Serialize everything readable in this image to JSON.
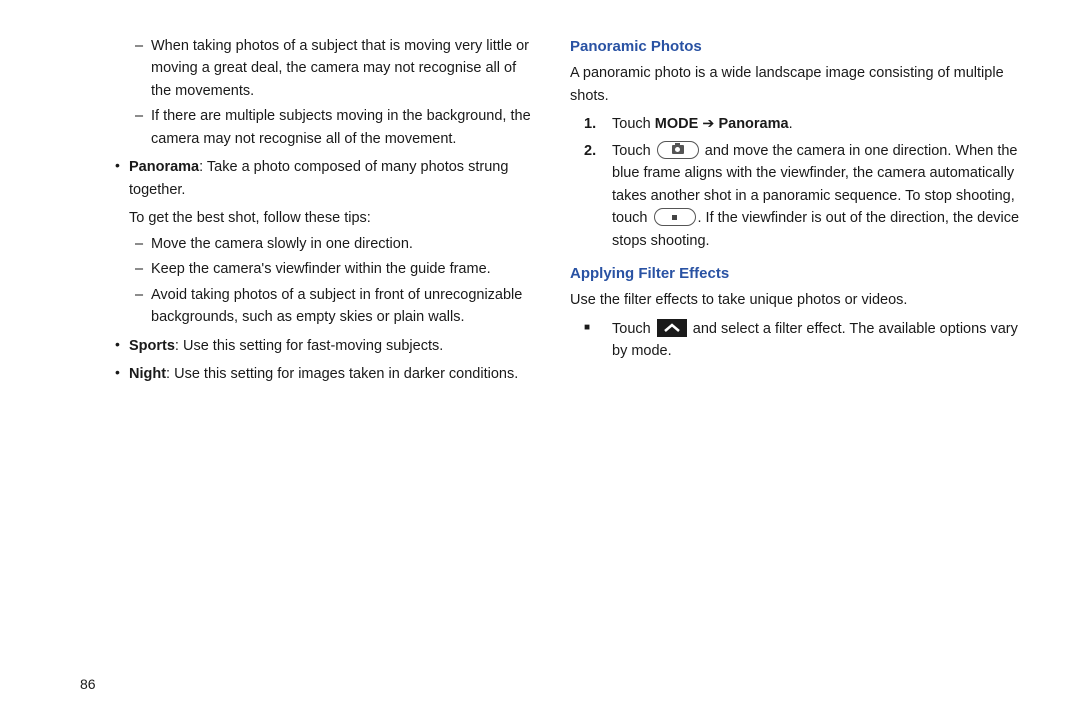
{
  "page_number": "86",
  "left": {
    "dash1": "When taking photos of a subject that is moving very little or moving a great deal, the camera may not recognise all of the movements.",
    "dash2": "If there are multiple subjects moving in the background, the camera may not recognise all of the movement.",
    "panorama_label": "Panorama",
    "panorama_text": ": Take a photo composed of many photos strung together.",
    "tips_intro": "To get the best shot, follow these tips:",
    "tip1": "Move the camera slowly in one direction.",
    "tip2": "Keep the camera's viewfinder within the guide frame.",
    "tip3": "Avoid taking photos of a subject in front of unrecognizable backgrounds, such as empty skies or plain walls.",
    "sports_label": "Sports",
    "sports_text": ": Use this setting for fast-moving subjects.",
    "night_label": "Night",
    "night_text": ": Use this setting for images taken in darker conditions."
  },
  "right": {
    "heading1": "Panoramic Photos",
    "para1": "A panoramic photo is a wide landscape image consisting of multiple shots.",
    "step1_pre": "Touch ",
    "step1_mode": "MODE",
    "step1_arrow": " ➔ ",
    "step1_panorama": "Panorama",
    "step1_post": ".",
    "step2_pre": "Touch ",
    "step2_mid": " and move the camera in one direction. When the blue frame aligns with the viewfinder, the camera automatically takes another shot in a panoramic sequence. To stop shooting, touch ",
    "step2_post": ". If the viewfinder is out of the direction, the device stops shooting.",
    "heading2": "Applying Filter Effects",
    "para2": "Use the filter effects to take unique photos or videos.",
    "filter_pre": "Touch ",
    "filter_post": " and select a filter effect. The available options vary by mode."
  }
}
